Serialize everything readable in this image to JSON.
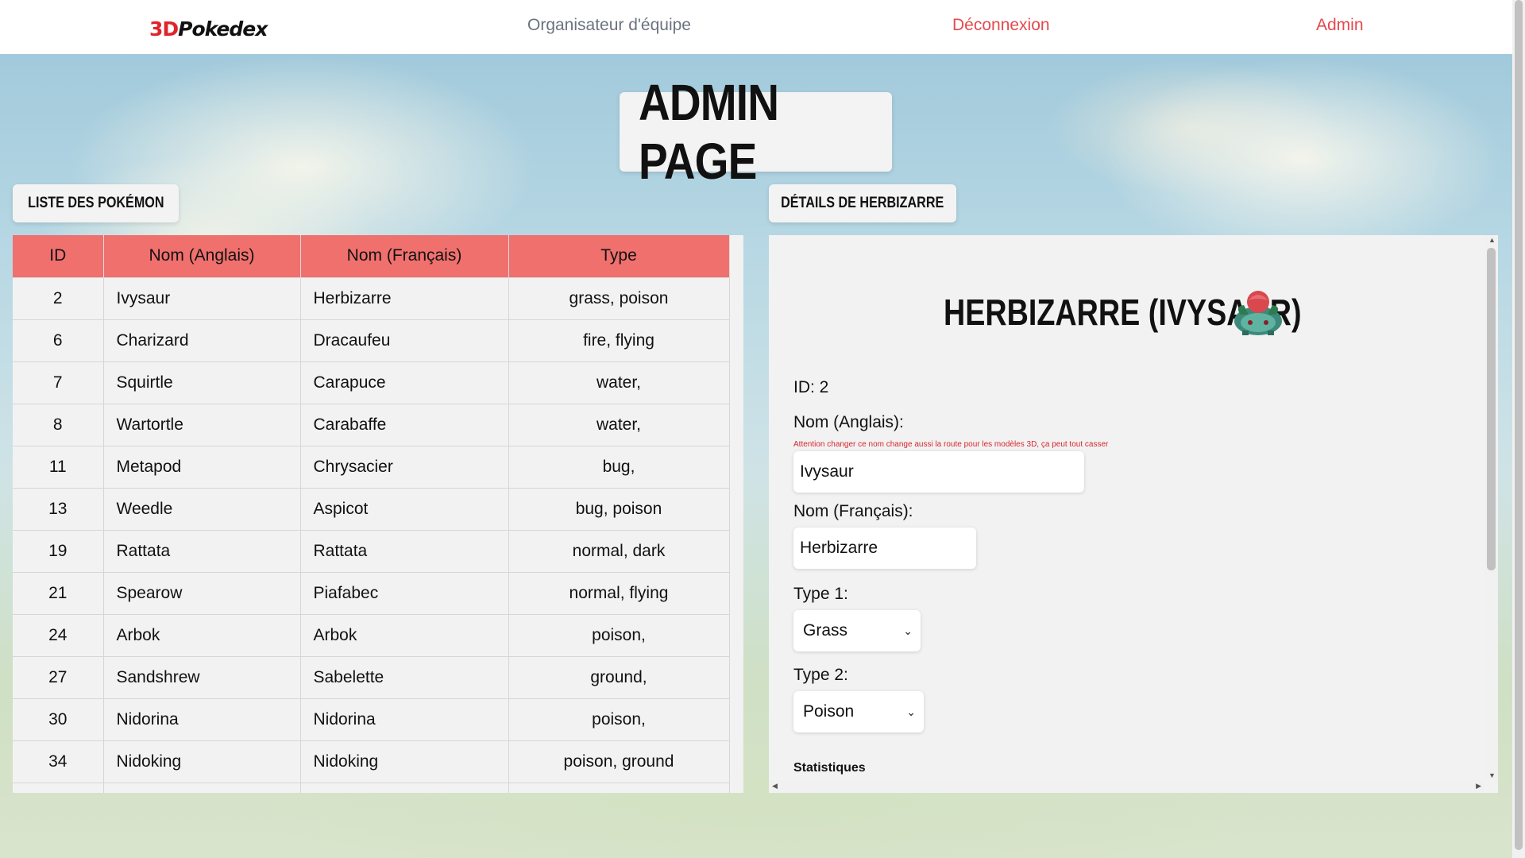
{
  "nav": {
    "logo_3d": "3D",
    "logo_rest": "Pokedex",
    "team": "Organisateur d'équipe",
    "logout": "Déconnexion",
    "admin": "Admin"
  },
  "page": {
    "title": "ADMIN PAGE",
    "list_tab": "LISTE DES POKÉMON",
    "details_tab": "DÉTAILS DE HERBIZARRE"
  },
  "table": {
    "headers": [
      "ID",
      "Nom (Anglais)",
      "Nom (Français)",
      "Type"
    ],
    "rows": [
      {
        "id": "2",
        "en": "Ivysaur",
        "fr": "Herbizarre",
        "type": "grass, poison"
      },
      {
        "id": "6",
        "en": "Charizard",
        "fr": "Dracaufeu",
        "type": "fire, flying"
      },
      {
        "id": "7",
        "en": "Squirtle",
        "fr": "Carapuce",
        "type": "water,"
      },
      {
        "id": "8",
        "en": "Wartortle",
        "fr": "Carabaffe",
        "type": "water,"
      },
      {
        "id": "11",
        "en": "Metapod",
        "fr": "Chrysacier",
        "type": "bug,"
      },
      {
        "id": "13",
        "en": "Weedle",
        "fr": "Aspicot",
        "type": "bug, poison"
      },
      {
        "id": "19",
        "en": "Rattata",
        "fr": "Rattata",
        "type": "normal, dark"
      },
      {
        "id": "21",
        "en": "Spearow",
        "fr": "Piafabec",
        "type": "normal, flying"
      },
      {
        "id": "24",
        "en": "Arbok",
        "fr": "Arbok",
        "type": "poison,"
      },
      {
        "id": "27",
        "en": "Sandshrew",
        "fr": "Sabelette",
        "type": "ground,"
      },
      {
        "id": "30",
        "en": "Nidorina",
        "fr": "Nidorina",
        "type": "poison,"
      },
      {
        "id": "34",
        "en": "Nidoking",
        "fr": "Nidoking",
        "type": "poison, ground"
      },
      {
        "id": "",
        "en": "",
        "fr": "",
        "type": ""
      }
    ]
  },
  "details": {
    "title": "HERBIZARRE (IVYSAUR)",
    "id_line": "ID: 2",
    "name_en_label": "Nom (Anglais):",
    "warning": "Attention changer ce nom change aussi la route pour les modèles 3D, ça peut tout casser",
    "name_en_value": "Ivysaur",
    "name_fr_label": "Nom (Français):",
    "name_fr_value": "Herbizarre",
    "type1_label": "Type 1:",
    "type1_value": "Grass",
    "type2_label": "Type 2:",
    "type2_value": "Poison",
    "stats_label": "Statistiques"
  },
  "icons": {
    "sprite": "ivysaur-sprite-icon",
    "select_arrow": "chevron-down-icon"
  },
  "colors": {
    "table_header": "#f0706e",
    "nav_red": "#e5484d",
    "nav_gray": "#6b7280",
    "warning": "#d7262b"
  }
}
